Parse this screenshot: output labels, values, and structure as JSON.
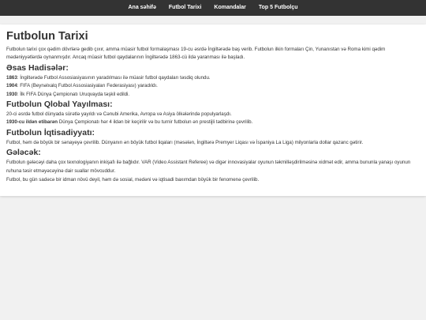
{
  "nav": {
    "items": [
      {
        "label": "Ana səhifə"
      },
      {
        "label": "Futbol Tarixi"
      },
      {
        "label": "Komandalar"
      },
      {
        "label": "Top 5 Futbolçu"
      }
    ]
  },
  "page": {
    "title": "Futbolun Tarixi",
    "intro": "Futbolun tarixi çox qədim dövrlərə gedib çıxır, amma müasir futbol formalaşması 19-cu əsrdə İngiltərədə baş verib. Futbolun ilkin formaları Çin, Yunanıstan və Roma kimi qədim mədəniyyətlərdə oynanmışdır. Ancaq müasir futbol qaydalarının İngiltərədə 1863-cü ildə yaranması ilə başladı."
  },
  "events": {
    "heading": "Əsas Hadisələr:",
    "items": [
      {
        "year": "1863",
        "text": ": İngiltərədə Futbol Assosiasiyasının yaradılması ilə müasir futbol qaydaları təsdiq olundu."
      },
      {
        "year": "1904",
        "text": ": FIFA (Beynəlxalq Futbol Assosiasiyaları Federasiyası) yaradıldı."
      },
      {
        "year": "1930",
        "text": ": İlk FIFA Dünya Çempionatı Uruqvayda təşkil edildi."
      }
    ]
  },
  "global": {
    "heading": "Futbolun Qlobal Yayılması:",
    "item1": "20-ci əsrdə futbol dünyada sürətlə yayıldı və Cənubi Amerika, Avropa və Asiya ölkələrində populyarlaşdı.",
    "item2_bold": "1930-cu ildən etibarən",
    "item2_text": " Dünya Çempionatı hər 4 ildən bir keçirilir və bu turnir futbolun ən prestijli tədbirinə çevrilib."
  },
  "economy": {
    "heading": "Futbolun İqtisadiyyatı:",
    "text": "Futbol, həm də böyük bir sənayeyə çevrilib. Dünyanın ən böyük futbol liqaları (məsələn, İngiltərə Premyer Liqası və İspaniya La Liga) milyonlarla dollar qazanc gətirir."
  },
  "future": {
    "heading": "Gələcək:",
    "text1": "Futbolun gələcəyi daha çox texnologiyanın inkişafı ilə bağlıdır. VAR (Video Assistant Referee) və digər innovasiyalar oyunun təkmilləşdirilməsinə xidmət edir, amma bununla yanaşı oyunun ruhuna təsir etməyəcəyinə dair suallar mövcuddur.",
    "text2": "Futbol, bu gün sadəcə bir idman növü deyil, həm də sosial, mədəni və iqtisadi baxımdan böyük bir fenomenə çevrilib."
  },
  "colors": {
    "nav_bg": "#333333",
    "nav_text": "#ffffff",
    "page_bg": "#f1f1f1",
    "content_bg": "#ffffff",
    "text": "#333333"
  }
}
